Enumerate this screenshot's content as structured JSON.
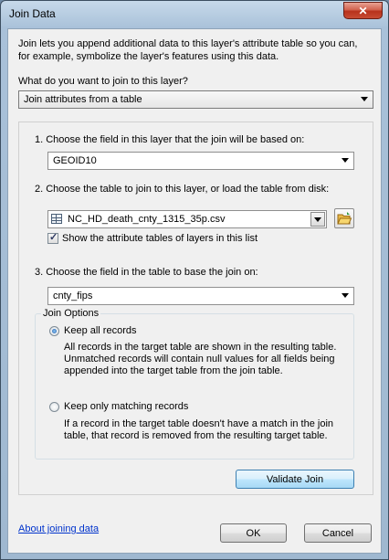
{
  "window": {
    "title": "Join Data",
    "close_glyph": "✕"
  },
  "intro": {
    "line1": "Join lets you append additional data to this layer's attribute table so you can,",
    "line2": "for example, symbolize the layer's features using this data."
  },
  "join_type": {
    "question": "What do you want to join to this layer?",
    "selected": "Join attributes from a table"
  },
  "step1": {
    "label": "1.  Choose the field in this layer that the join will be based on:",
    "value": "GEOID10"
  },
  "step2": {
    "label": "2.  Choose the table to join to this layer, or load the table from disk:",
    "value": "NC_HD_death_cnty_1315_35p.csv",
    "show_layers_label": "Show the attribute tables of layers in this list",
    "show_layers_checked": true
  },
  "step3": {
    "label": "3.  Choose the field in the table to base the join on:",
    "value": "cnty_fips"
  },
  "join_options": {
    "title": "Join Options",
    "keep_all": {
      "label": "Keep all records",
      "selected": true,
      "desc1": "All records in the target table are shown in the resulting table.",
      "desc2": "Unmatched records will contain null values for all fields being",
      "desc3": "appended into the target table from the join table."
    },
    "keep_matching": {
      "label": "Keep only matching records",
      "selected": false,
      "desc1": "If a record in the target table doesn't have a match in the join",
      "desc2": "table, that record is removed from the resulting target table."
    }
  },
  "buttons": {
    "validate": "Validate Join",
    "ok": "OK",
    "cancel": "Cancel"
  },
  "footer": {
    "help_link": "About joining data"
  },
  "icons": {
    "table": "table-icon",
    "open_folder": "open-folder-icon",
    "dropdown": "chevron-down-icon"
  }
}
